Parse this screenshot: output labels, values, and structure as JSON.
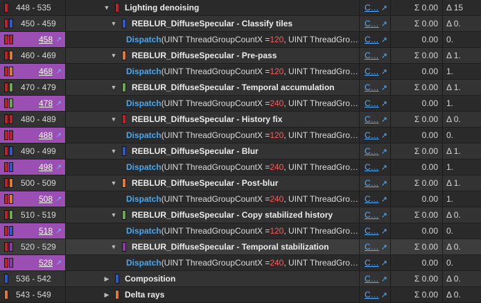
{
  "colors": {
    "red": "#c0202a",
    "blue": "#2f58c8",
    "orange": "#e07b2c",
    "green": "#6ea84a",
    "purple": "#8a3aa8",
    "highlight": "#9b4fb3"
  },
  "common": {
    "dispatch": "Dispatch",
    "args_pre": "(UINT ThreadGroupCountX = ",
    "args_post": ", UINT ThreadGro…",
    "link": "C…",
    "link_arrow": "↗"
  },
  "rows": [
    {
      "type": "group",
      "range": "448 - 535",
      "sw": [
        "red"
      ],
      "expand": "▼",
      "indent": 0,
      "name": "Lighting denoising",
      "v1": "Σ 0.00",
      "v2": "Δ 15"
    },
    {
      "type": "group",
      "range": "450 - 459",
      "sw": [
        "red",
        "blue"
      ],
      "expand": "▼",
      "indent": 1,
      "name": "REBLUR_DiffuseSpecular - Classify tiles",
      "v1": "Σ 0.00",
      "v2": "Δ 0."
    },
    {
      "type": "dispatch",
      "id": "458",
      "sw": [
        "red",
        "red"
      ],
      "count": "120",
      "v1": "0.00",
      "v2": "0."
    },
    {
      "type": "group",
      "range": "460 - 469",
      "sw": [
        "red",
        "orange"
      ],
      "expand": "▼",
      "indent": 1,
      "name": "REBLUR_DiffuseSpecular - Pre-pass",
      "v1": "Σ 0.00",
      "v2": "Δ 1."
    },
    {
      "type": "dispatch",
      "id": "468",
      "sw": [
        "red",
        "orange"
      ],
      "count": "120",
      "v1": "0.00",
      "v2": "1."
    },
    {
      "type": "group",
      "range": "470 - 479",
      "sw": [
        "red",
        "green"
      ],
      "expand": "▼",
      "indent": 1,
      "name": "REBLUR_DiffuseSpecular - Temporal accumulation",
      "v1": "Σ 0.00",
      "v2": "Δ 1."
    },
    {
      "type": "dispatch",
      "id": "478",
      "sw": [
        "red",
        "green"
      ],
      "count": "240",
      "v1": "0.00",
      "v2": "1."
    },
    {
      "type": "group",
      "range": "480 - 489",
      "sw": [
        "red",
        "red"
      ],
      "expand": "▼",
      "indent": 1,
      "name": "REBLUR_DiffuseSpecular - History fix",
      "v1": "Σ 0.00",
      "v2": "Δ 0."
    },
    {
      "type": "dispatch",
      "id": "488",
      "sw": [
        "red",
        "red"
      ],
      "count": "120",
      "v1": "0.00",
      "v2": "0."
    },
    {
      "type": "group",
      "range": "490 - 499",
      "sw": [
        "red",
        "blue"
      ],
      "expand": "▼",
      "indent": 1,
      "name": "REBLUR_DiffuseSpecular - Blur",
      "v1": "Σ 0.00",
      "v2": "Δ 1."
    },
    {
      "type": "dispatch",
      "id": "498",
      "sw": [
        "red",
        "blue"
      ],
      "count": "240",
      "v1": "0.00",
      "v2": "1."
    },
    {
      "type": "group",
      "range": "500 - 509",
      "sw": [
        "red",
        "orange"
      ],
      "expand": "▼",
      "indent": 1,
      "name": "REBLUR_DiffuseSpecular - Post-blur",
      "v1": "Σ 0.00",
      "v2": "Δ 1."
    },
    {
      "type": "dispatch",
      "id": "508",
      "sw": [
        "red",
        "orange"
      ],
      "count": "240",
      "v1": "0.00",
      "v2": "1."
    },
    {
      "type": "group",
      "range": "510 - 519",
      "sw": [
        "red",
        "green"
      ],
      "expand": "▼",
      "indent": 1,
      "name": "REBLUR_DiffuseSpecular - Copy stabilized history",
      "v1": "Σ 0.00",
      "v2": "Δ 0."
    },
    {
      "type": "dispatch",
      "id": "518",
      "sw": [
        "red",
        "blue"
      ],
      "count": "120",
      "v1": "0.00",
      "v2": "0."
    },
    {
      "type": "group",
      "range": "520 - 529",
      "sw": [
        "red",
        "purple"
      ],
      "expand": "▼",
      "indent": 1,
      "name": "REBLUR_DiffuseSpecular - Temporal stabilization",
      "v1": "Σ 0.00",
      "v2": "Δ 0.",
      "selected": true
    },
    {
      "type": "dispatch",
      "id": "528",
      "sw": [
        "red",
        "purple"
      ],
      "count": "240",
      "v1": "0.00",
      "v2": "0."
    },
    {
      "type": "group",
      "range": "536 - 542",
      "sw": [
        "blue"
      ],
      "expand": "▶",
      "indent": 0,
      "name": "Composition",
      "v1": "Σ 0.00",
      "v2": "Δ 0."
    },
    {
      "type": "group",
      "range": "543 - 549",
      "sw": [
        "orange"
      ],
      "expand": "▶",
      "indent": 0,
      "name": "Delta rays",
      "v1": "Σ 0.00",
      "v2": "Δ 0."
    }
  ]
}
